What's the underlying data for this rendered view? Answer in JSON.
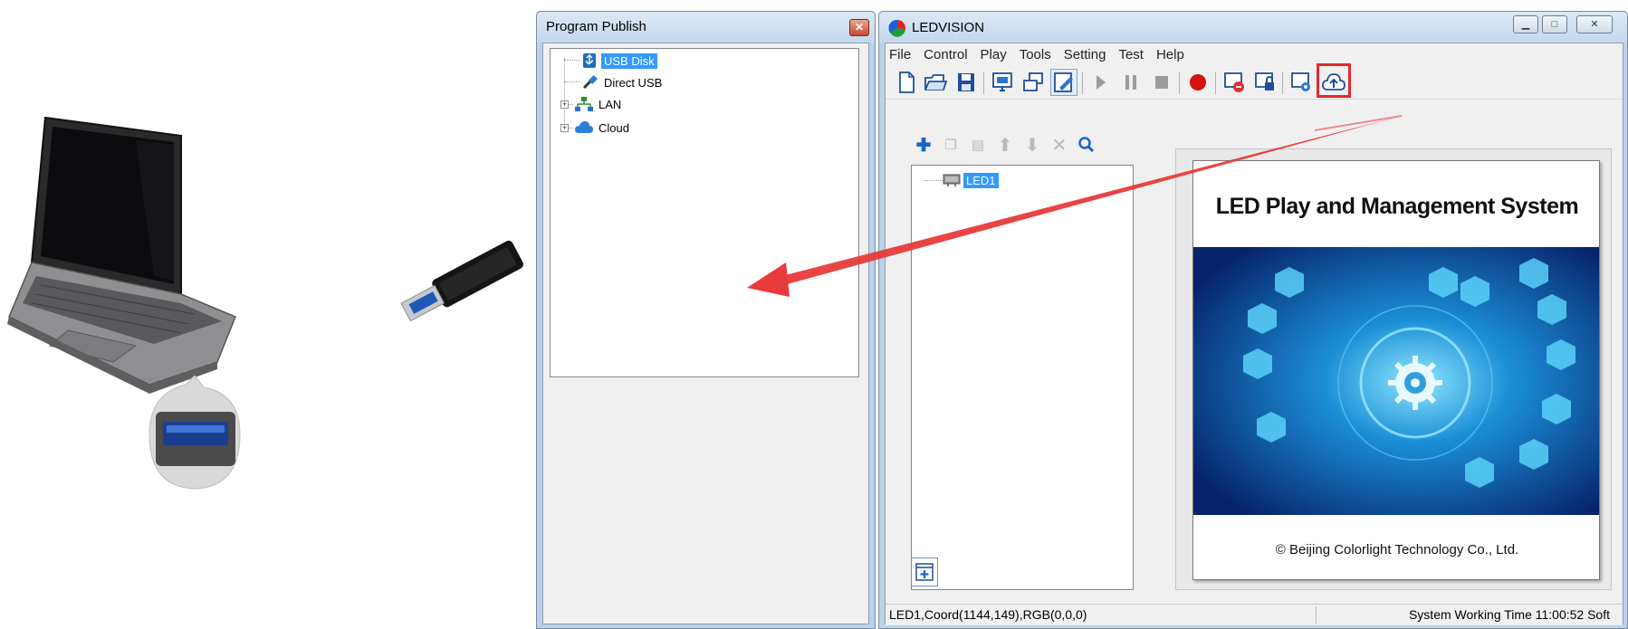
{
  "program_publish": {
    "title": "Program Publish",
    "tree": [
      {
        "label": "USB Disk",
        "selected": true,
        "icon": "usb-icon"
      },
      {
        "label": "Direct USB",
        "selected": false,
        "icon": "usb-cable-icon"
      },
      {
        "label": "LAN",
        "selected": false,
        "icon": "network-icon",
        "expandable": true
      },
      {
        "label": "Cloud",
        "selected": false,
        "icon": "cloud-icon",
        "expandable": true
      }
    ]
  },
  "ledvision": {
    "title": "LEDVISION",
    "menu": [
      "File",
      "Control",
      "Play",
      "Tools",
      "Setting",
      "Test",
      "Help"
    ],
    "toolbar_icons": [
      "new-file-icon",
      "open-folder-icon",
      "save-icon",
      "display-icon",
      "window-icon",
      "edit-icon",
      "play-icon",
      "pause-icon",
      "stop-icon",
      "record-icon",
      "close-screen-icon",
      "lock-screen-icon",
      "settings-screen-icon",
      "cloud-upload-icon"
    ],
    "highlighted_tool": "cloud-upload-icon",
    "subtool_icons": [
      "add-icon",
      "copy-icon",
      "paste-icon",
      "move-up-icon",
      "move-down-icon",
      "delete-icon",
      "search-icon"
    ],
    "screen_tree": [
      {
        "label": "LED1",
        "selected": true
      }
    ],
    "splash": {
      "title": "LED Play and Management System",
      "copyright": "© Beijing Colorlight Technology Co., Ltd."
    },
    "status": {
      "left": "LED1,Coord(1144,149),RGB(0,0,0)",
      "right": "System Working Time 11:00:52 Soft"
    },
    "caption_buttons": [
      "minimize",
      "maximize",
      "close"
    ]
  },
  "colors": {
    "highlight": "#e32a2a",
    "selection": "#3399ff",
    "title_bar": "#c4d7ec"
  }
}
